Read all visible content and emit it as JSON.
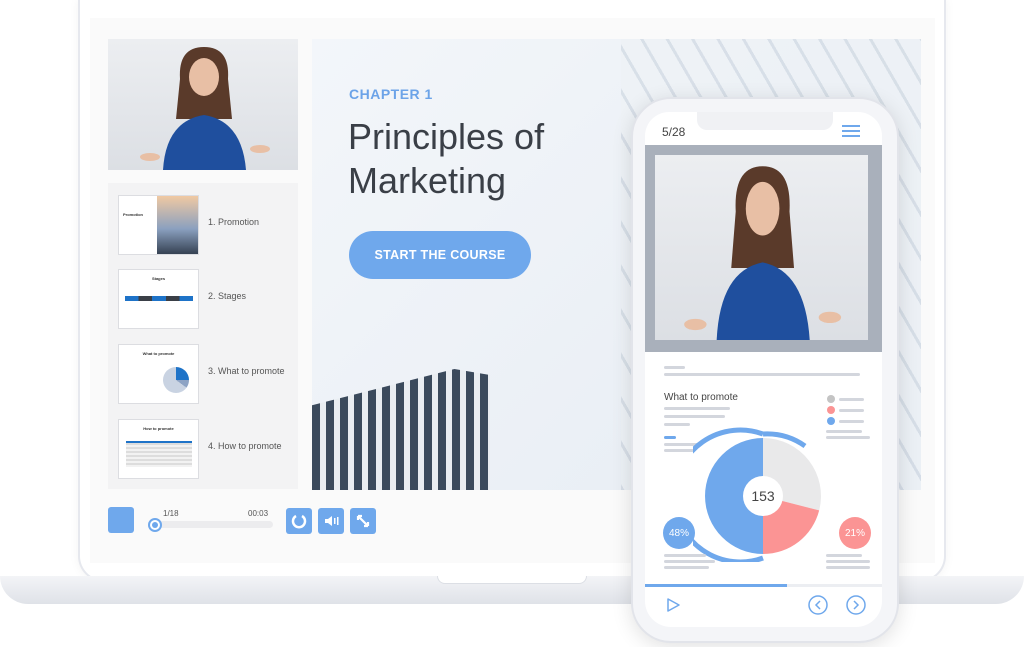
{
  "laptop": {
    "sidebar": {
      "items": [
        {
          "label": "1. Promotion",
          "thumb_title": "Promotion"
        },
        {
          "label": "2. Stages",
          "thumb_title": "Stages"
        },
        {
          "label": "3. What to promote",
          "thumb_title": "What to promote"
        },
        {
          "label": "4. How to promote",
          "thumb_title": "How to promote"
        }
      ]
    },
    "slide": {
      "chapter": "CHAPTER 1",
      "title": "Principles of Marketing",
      "start_button": "START THE COURSE"
    },
    "player": {
      "slide_counter": "1/18",
      "time": "00:03",
      "progress": 0.02,
      "icons": [
        "stop-icon",
        "replay-icon",
        "volume-icon",
        "fullscreen-icon"
      ]
    }
  },
  "phone": {
    "page_counter": "5/28",
    "chart": {
      "title": "What to promote",
      "center_value": "153",
      "left_badge": "48%",
      "right_badge": "21%",
      "slices": [
        {
          "value": 50,
          "color": "#6fa8ec"
        },
        {
          "value": 29,
          "color": "#e9e9ea"
        },
        {
          "value": 21,
          "color": "#fb9494"
        }
      ]
    },
    "progress": 0.6,
    "colors": {
      "accent": "#6fa8ec",
      "red": "#fb9494",
      "gray": "#c4c4c4"
    }
  }
}
